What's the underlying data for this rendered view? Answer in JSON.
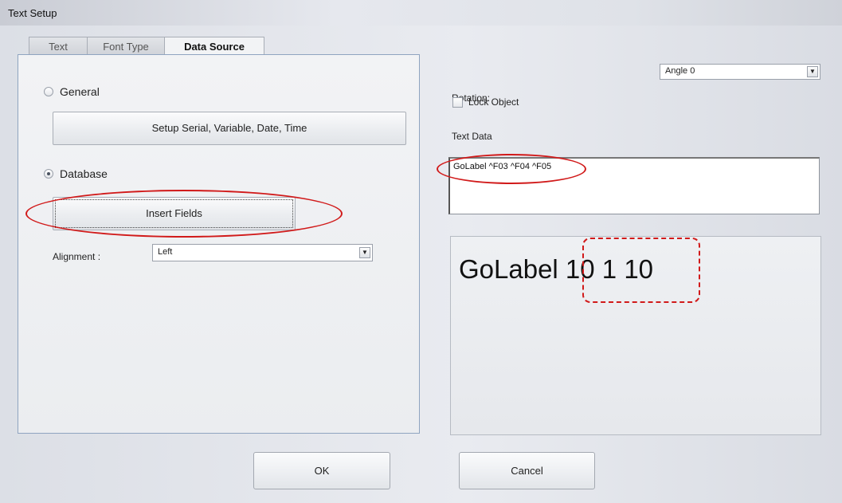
{
  "window": {
    "title": "Text Setup"
  },
  "tabs": [
    {
      "label": "Text",
      "active": false
    },
    {
      "label": "Font Type",
      "active": false
    },
    {
      "label": "Data Source",
      "active": true
    }
  ],
  "data_source": {
    "general_label": "General",
    "general_checked": false,
    "setup_button_label": "Setup Serial, Variable, Date, Time",
    "database_label": "Database",
    "database_checked": true,
    "insert_fields_label": "Insert Fields",
    "alignment_label": "Alignment :",
    "alignment_value": "Left"
  },
  "right_panel": {
    "rotation_label": "Rotation:",
    "rotation_value": "Angle 0",
    "lock_object_label": "Lock Object",
    "lock_object_checked": false,
    "text_data_label": "Text Data",
    "text_data_value": "GoLabel ^F03 ^F04 ^F05",
    "preview_text": "GoLabel 10 1 10"
  },
  "footer": {
    "ok_label": "OK",
    "cancel_label": "Cancel"
  },
  "annotation_color": "#d11a1a"
}
